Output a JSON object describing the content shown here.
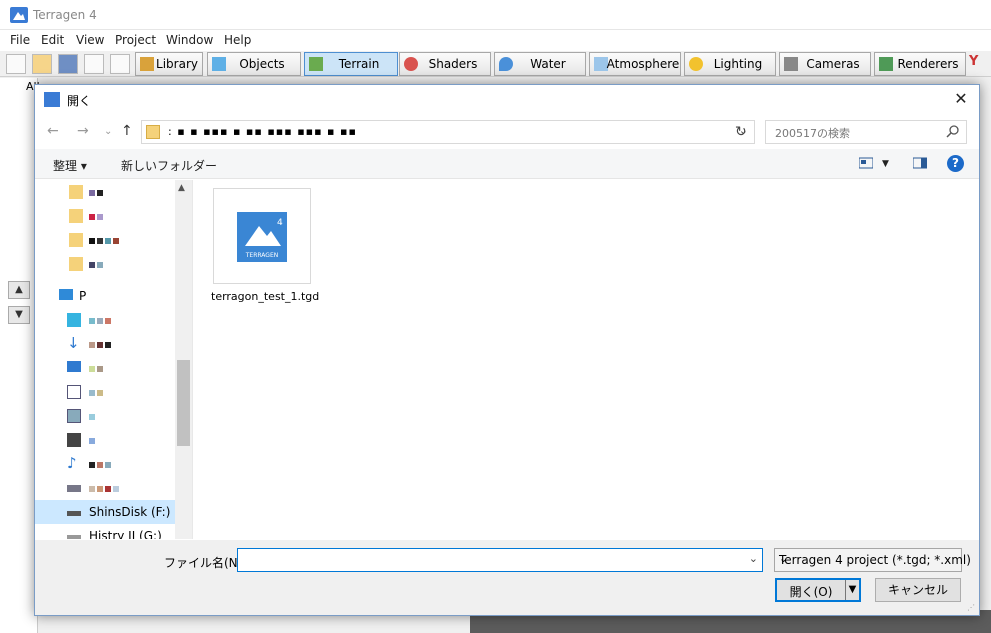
{
  "app": {
    "title": "Terragen 4"
  },
  "menu": [
    "File",
    "Edit",
    "View",
    "Project",
    "Window",
    "Help"
  ],
  "toolbar": {
    "buttons": [
      "Library",
      "Objects",
      "Terrain",
      "Shaders",
      "Water",
      "Atmosphere",
      "Lighting",
      "Cameras",
      "Renderers"
    ],
    "active": "Terrain"
  },
  "left_panel": {
    "up_label": "▲",
    "down_label": "▼",
    "tab": "All"
  },
  "dialog": {
    "title": "開く",
    "close_label": "✕",
    "address_path": ": ▪ ▪ ▪▪▪ ▪ ▪▪ ▪▪▪ ▪▪▪ ▪ ▪▪",
    "search_placeholder": "200517の検索",
    "organize": "整理 ▾",
    "new_folder": "新しいフォルダー",
    "help": "?",
    "nav_items": [
      {
        "label": "",
        "icon": "folder-icon"
      },
      {
        "label": "",
        "icon": "folder-icon"
      },
      {
        "label": "",
        "icon": "folder-icon"
      },
      {
        "label": "",
        "icon": "folder-icon"
      },
      {
        "label": "P",
        "icon": "pc-icon"
      },
      {
        "label": "",
        "icon": "3d-objects-icon"
      },
      {
        "label": "",
        "icon": "download-icon"
      },
      {
        "label": "",
        "icon": "desktop-icon"
      },
      {
        "label": "",
        "icon": "document-icon"
      },
      {
        "label": "",
        "icon": "picture-icon"
      },
      {
        "label": "",
        "icon": "video-icon"
      },
      {
        "label": "",
        "icon": "music-icon"
      },
      {
        "label": "",
        "icon": "drive-icon"
      },
      {
        "label": "ShinsDisk (F:)",
        "icon": "drive-icon",
        "selected": true
      },
      {
        "label": "Histry II (G:)",
        "icon": "drive-icon"
      }
    ],
    "files": [
      {
        "name": "terragon_test_1.tgd",
        "icon": "terragen-file-icon",
        "badge": "4",
        "brand": "TERRAGEN"
      }
    ],
    "filename_label": "ファイル名(N):",
    "filename_value": "",
    "filetype": "Terragen 4 project (*.tgd; *.xml)",
    "open_label": "開く(O)",
    "cancel_label": "キャンセル"
  },
  "colors": {
    "accent": "#0078d7",
    "selection": "#cce8ff",
    "terragen_blue": "#3a86d4"
  }
}
